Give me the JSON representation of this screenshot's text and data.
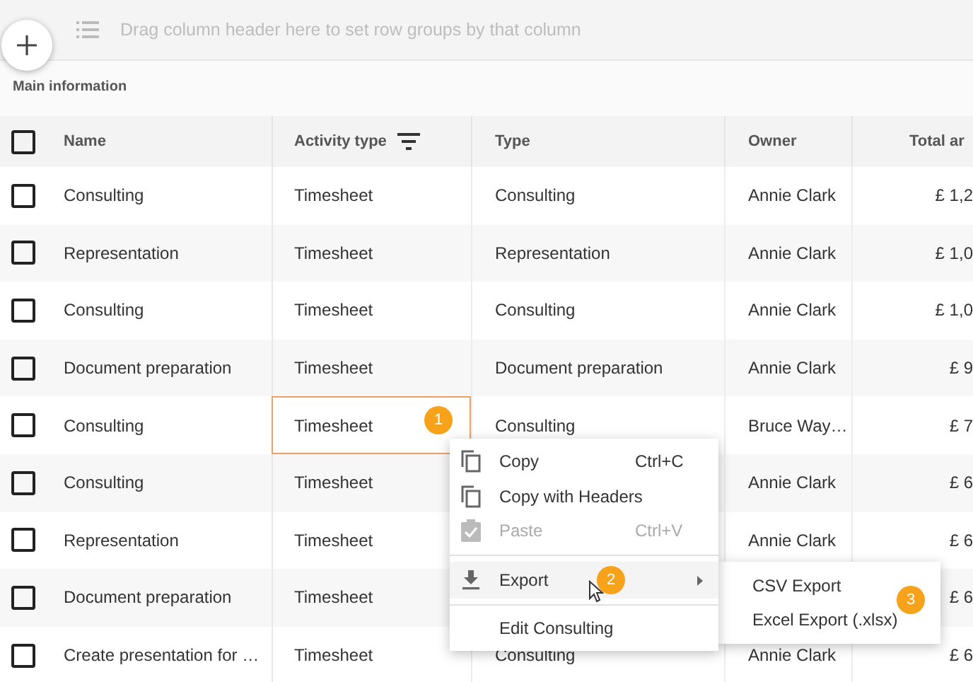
{
  "group_bar": {
    "placeholder": "Drag column header here to set row groups by that column"
  },
  "section_title": "Main information",
  "table": {
    "select_all_checked": false,
    "columns": [
      {
        "label": "Name",
        "filtered": false
      },
      {
        "label": "Activity type",
        "filtered": true
      },
      {
        "label": "Type",
        "filtered": false
      },
      {
        "label": "Owner",
        "filtered": false
      },
      {
        "label": "Total ar",
        "filtered": false
      }
    ],
    "rows": [
      {
        "checked": false,
        "cells": [
          "Consulting",
          "Timesheet",
          "Consulting",
          "Annie Clark",
          "£ 1,2"
        ],
        "activity_selected": false
      },
      {
        "checked": false,
        "cells": [
          "Representation",
          "Timesheet",
          "Representation",
          "Annie Clark",
          "£ 1,0"
        ],
        "activity_selected": false
      },
      {
        "checked": false,
        "cells": [
          "Consulting",
          "Timesheet",
          "Consulting",
          "Annie Clark",
          "£ 1,0"
        ],
        "activity_selected": false
      },
      {
        "checked": false,
        "cells": [
          "Document preparation",
          "Timesheet",
          "Document preparation",
          "Annie Clark",
          "£ 9"
        ],
        "activity_selected": false
      },
      {
        "checked": false,
        "cells": [
          "Consulting",
          "Timesheet",
          "Consulting",
          "Bruce Way…",
          "£ 7"
        ],
        "activity_selected": true,
        "badge": "1"
      },
      {
        "checked": false,
        "cells": [
          "Consulting",
          "Timesheet",
          null,
          "Annie Clark",
          "£ 6"
        ],
        "activity_selected": false
      },
      {
        "checked": false,
        "cells": [
          "Representation",
          "Timesheet",
          null,
          "Annie Clark",
          "£ 6"
        ],
        "activity_selected": false
      },
      {
        "checked": false,
        "cells": [
          "Document preparation",
          "Timesheet",
          null,
          null,
          "£ 6"
        ],
        "activity_selected": false
      },
      {
        "checked": false,
        "cells": [
          "Create presentation for …",
          "Timesheet",
          "Consulting",
          "Annie Clark",
          "£ 6"
        ],
        "activity_selected": false
      }
    ]
  },
  "context_menu": {
    "items": [
      {
        "kind": "copy",
        "label": "Copy",
        "shortcut": "Ctrl+C",
        "disabled": false,
        "highlighted": false
      },
      {
        "kind": "copy",
        "label": "Copy with Headers",
        "disabled": false,
        "highlighted": false
      },
      {
        "kind": "paste",
        "label": "Paste",
        "shortcut": "Ctrl+V",
        "disabled": true,
        "highlighted": false
      },
      {
        "kind": "divider"
      },
      {
        "kind": "export",
        "label": "Export",
        "disabled": false,
        "highlighted": true,
        "badge": "2",
        "submenu": {
          "badge": "3",
          "items": [
            {
              "label": "CSV Export"
            },
            {
              "label": "Excel Export (.xlsx)"
            }
          ]
        }
      },
      {
        "kind": "divider"
      },
      {
        "kind": "plain",
        "label": "Edit Consulting",
        "disabled": false,
        "highlighted": false
      }
    ]
  }
}
